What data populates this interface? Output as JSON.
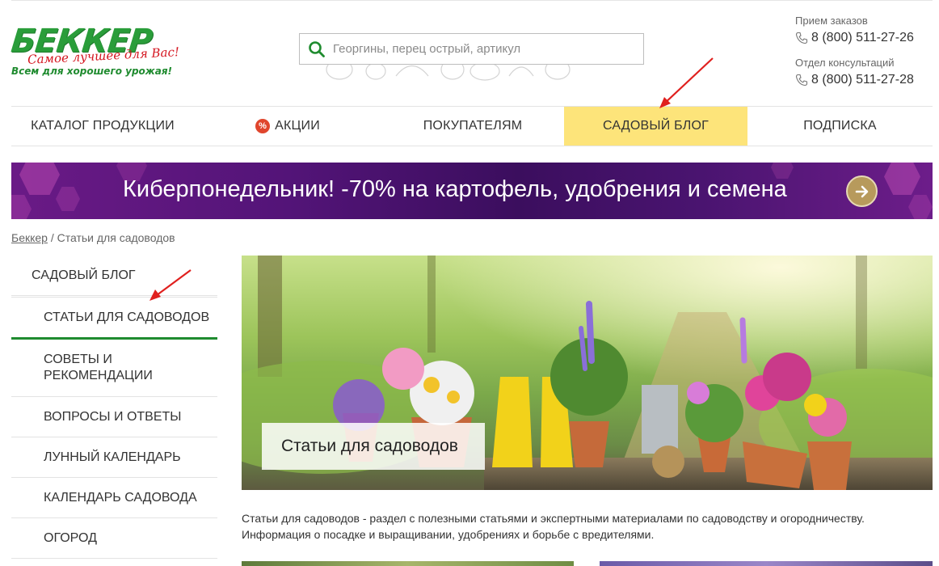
{
  "header": {
    "logo": {
      "brand": "БЕККЕР",
      "slogan": "Самое лучшее для Вас!",
      "tagline": "Всем для хорошего урожая!"
    },
    "search": {
      "placeholder": "Георгины, перец острый, артикул"
    },
    "contacts": [
      {
        "label": "Прием заказов",
        "phone": "8 (800) 511-27-26"
      },
      {
        "label": "Отдел консультаций",
        "phone": "8 (800) 511-27-28"
      }
    ]
  },
  "nav": {
    "items": [
      {
        "label": "КАТАЛОГ ПРОДУКЦИИ",
        "active": false
      },
      {
        "label": "АКЦИИ",
        "active": false,
        "icon": "percent-icon",
        "icon_text": "%"
      },
      {
        "label": "ПОКУПАТЕЛЯМ",
        "active": false
      },
      {
        "label": "САДОВЫЙ БЛОГ",
        "active": true
      },
      {
        "label": "ПОДПИСКА",
        "active": false
      }
    ]
  },
  "banner": {
    "text": "Киберпонедельник! -70% на картофель, удобрения и семена"
  },
  "breadcrumb": {
    "home": "Беккер",
    "separator": "/",
    "current": "Статьи для садоводов"
  },
  "sidebar": {
    "title": "САДОВЫЙ БЛОГ",
    "items": [
      {
        "label": "СТАТЬИ ДЛЯ САДОВОДОВ",
        "active": true
      },
      {
        "label": "СОВЕТЫ И РЕКОМЕНДАЦИИ",
        "active": false
      },
      {
        "label": "ВОПРОСЫ И ОТВЕТЫ",
        "active": false
      },
      {
        "label": "ЛУННЫЙ КАЛЕНДАРЬ",
        "active": false
      },
      {
        "label": "КАЛЕНДАРЬ САДОВОДА",
        "active": false
      },
      {
        "label": "ОГОРОД",
        "active": false
      }
    ]
  },
  "hero": {
    "caption": "Статьи для садоводов"
  },
  "description": {
    "line1": "Статьи для садоводов - раздел с полезными статьями и экспертными материалами по садоводству и огородничеству.",
    "line2": "Информация о посадке и выращивании, удобрениях и борьбе с вредителями."
  },
  "colors": {
    "brand_green": "#2a9d3a",
    "active_nav": "#fde47a",
    "active_underline": "#1f8b2f",
    "banner_purple": "#531478",
    "annotation_red": "#e0201e"
  }
}
